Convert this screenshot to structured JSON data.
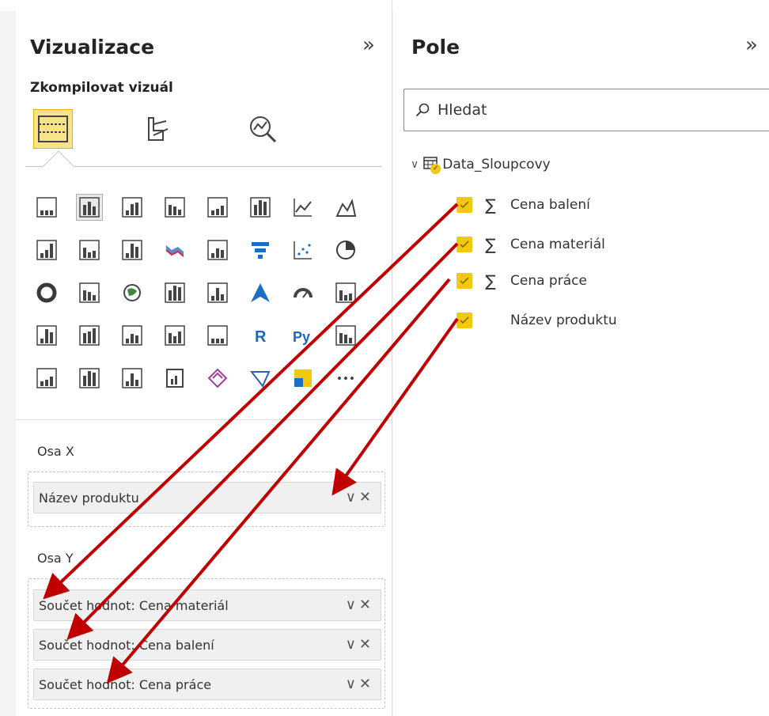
{
  "visualizations": {
    "title": "Vizualizace",
    "collapse_icon": "chevron-double-right-icon",
    "subtitle": "Zkompilovat vizuál",
    "build_tabs": [
      "build-visual-icon",
      "format-visual-icon",
      "analytics-icon"
    ],
    "axis_x": {
      "label": "Osa X",
      "fields": [
        {
          "name": "Název produktu"
        }
      ]
    },
    "axis_y": {
      "label": "Osa Y",
      "fields": [
        {
          "name": "Součet hodnot: Cena materiál"
        },
        {
          "name": "Součet hodnot: Cena balení"
        },
        {
          "name": "Součet hodnot: Cena práce"
        }
      ]
    }
  },
  "fields": {
    "title": "Pole",
    "collapse_icon": "chevron-double-right-icon",
    "search_placeholder": "Hledat",
    "table": {
      "name": "Data_Sloupcovy",
      "columns": [
        {
          "name": "Cena balení",
          "checked": true,
          "sigma": true
        },
        {
          "name": "Cena materiál",
          "checked": true,
          "sigma": true
        },
        {
          "name": "Cena práce",
          "checked": true,
          "sigma": true
        },
        {
          "name": "Název produktu",
          "checked": true,
          "sigma": false
        }
      ]
    }
  },
  "accent_color": "#f2c811",
  "arrow_color": "#c00000"
}
